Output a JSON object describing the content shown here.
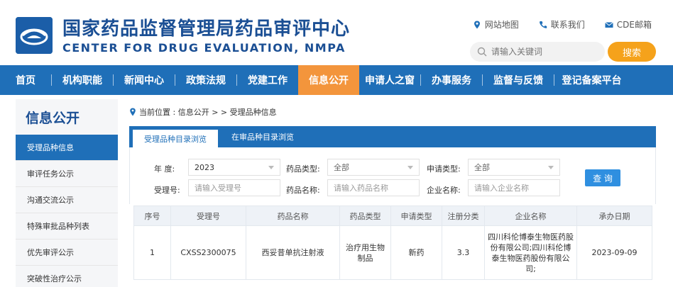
{
  "header": {
    "title_cn": "国家药品监督管理局药品审评中心",
    "title_en": "CENTER FOR DRUG EVALUATION, NMPA",
    "links": [
      "网站地图",
      "联系我们",
      "CDE邮箱"
    ],
    "search_placeholder": "请输入关键词",
    "search_button": "搜索"
  },
  "nav": {
    "items": [
      "首页",
      "机构职能",
      "新闻中心",
      "政策法规",
      "党建工作",
      "信息公开",
      "申请人之窗",
      "办事服务",
      "监督与反馈",
      "登记备案平台"
    ],
    "active": "信息公开"
  },
  "sidebar": {
    "title": "信息公开",
    "items": [
      "受理品种信息",
      "审评任务公示",
      "沟通交流公示",
      "特殊审批品种列表",
      "优先审评公示",
      "突破性治疗公示"
    ]
  },
  "breadcrumb": {
    "text": "当前位置 : 信息公开 > > 受理品种信息"
  },
  "tabs": [
    "受理品种目录浏览",
    "在审品种目录浏览"
  ],
  "filters": {
    "year_label": "年  度:",
    "year_value": "2023",
    "drug_type_label": "药品类型:",
    "drug_type_value": "全部",
    "apply_type_label": "申请类型:",
    "apply_type_value": "全部",
    "accept_no_label": "受理号:",
    "accept_no_placeholder": "请输入受理号",
    "drug_name_label": "药品名称:",
    "drug_name_placeholder": "请输入药品名称",
    "company_label": "企业名称:",
    "company_placeholder": "请输入企业名称",
    "query_button": "查 询"
  },
  "table": {
    "headers": [
      "序号",
      "受理号",
      "药品名称",
      "药品类型",
      "申请类型",
      "注册分类",
      "企业名称",
      "承办日期"
    ],
    "rows": [
      [
        "1",
        "CXSS2300075",
        "西妥昔单抗注射液",
        "治疗用生物制品",
        "新药",
        "3.3",
        "四川科伦博泰生物医药股份有限公司;四川科伦博泰生物医药股份有限公司;",
        "2023-09-09"
      ]
    ]
  },
  "colors": {
    "nav_blue": "#1f6fb8",
    "nav_active": "#f3953c",
    "brand_blue": "#1b4f94",
    "search_orange": "#f5a21b",
    "query_blue": "#2f8fe0"
  },
  "icons": {
    "logo": "cde-logo-icon",
    "sitemap": "location-pin-icon",
    "contact": "phone-icon",
    "mail": "mail-icon",
    "search": "search-icon"
  }
}
